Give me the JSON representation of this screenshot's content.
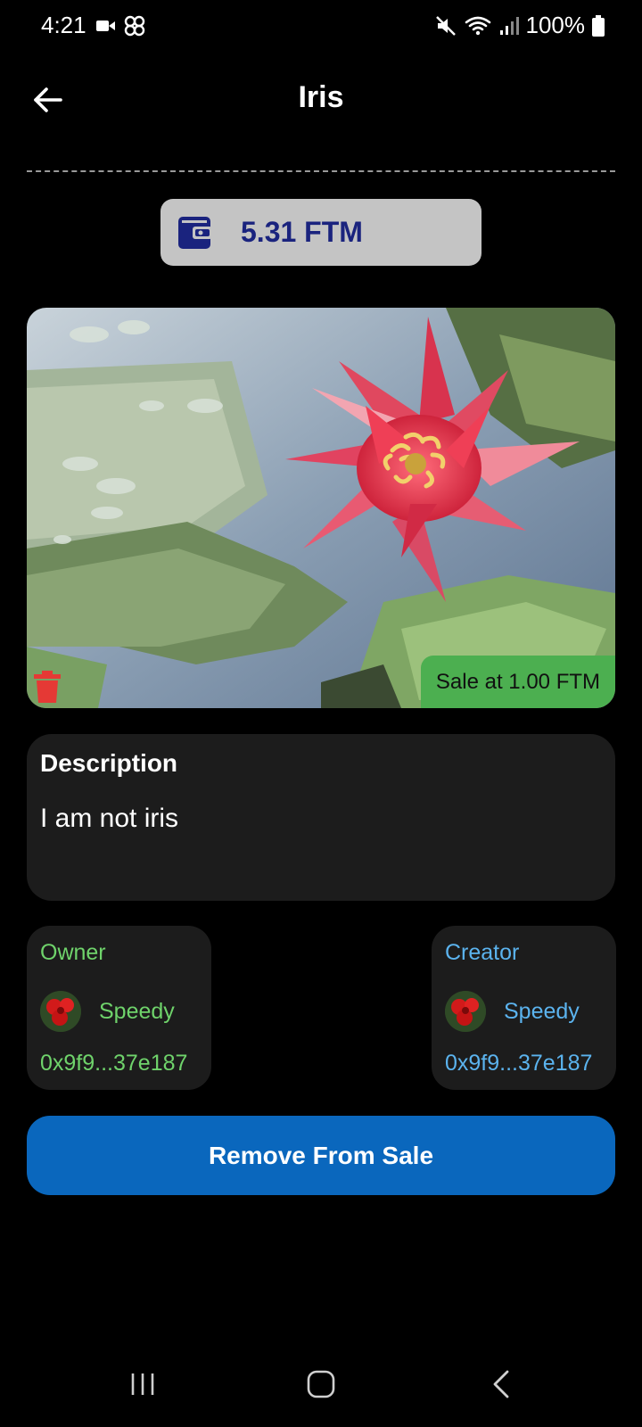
{
  "status_bar": {
    "time": "4:21",
    "battery": "100%",
    "icons": [
      "video-icon",
      "pinwheel-icon",
      "mute-icon",
      "wifi-icon",
      "signal-icon",
      "battery-icon"
    ]
  },
  "header": {
    "title": "Iris",
    "back_icon": "arrow-left-icon"
  },
  "balance": {
    "icon": "wallet-icon",
    "text": "5.31 FTM"
  },
  "nft": {
    "sale_badge": "Sale at 1.00 FTM",
    "delete_icon": "trash-icon"
  },
  "description": {
    "heading": "Description",
    "text": "I am not iris"
  },
  "owner": {
    "role": "Owner",
    "name": "Speedy",
    "address": "0x9f9...37e187"
  },
  "creator": {
    "role": "Creator",
    "name": "Speedy",
    "address": "0x9f9...37e187"
  },
  "actions": {
    "remove_label": "Remove From Sale"
  },
  "colors": {
    "background": "#000000",
    "card": "#1c1c1c",
    "owner_accent": "#6fd36b",
    "creator_accent": "#5bb3ee",
    "primary_button": "#0a67bd",
    "sale_badge": "#4caf50",
    "balance_chip": "#c4c4c4",
    "balance_text": "#1a237e",
    "delete": "#e53935"
  },
  "nav_bar": {
    "icons": [
      "recent-apps-icon",
      "home-icon",
      "back-icon"
    ]
  }
}
